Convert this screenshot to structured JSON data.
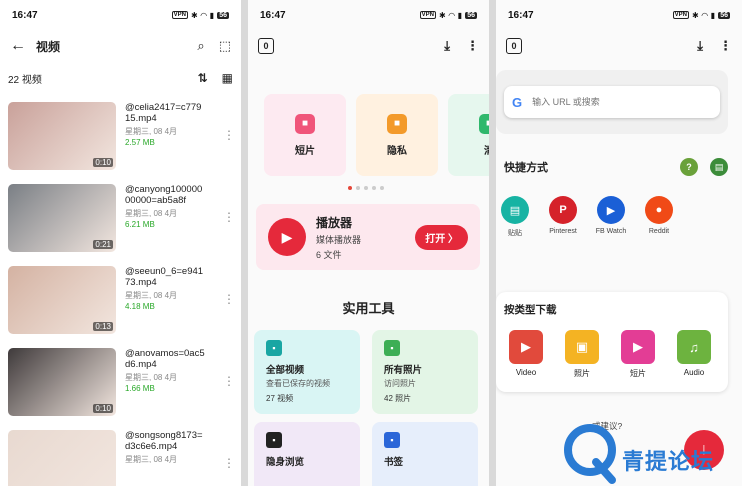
{
  "status": {
    "time": "16:47",
    "vpn": "VPN",
    "battery": "56"
  },
  "panel1": {
    "title": "视频",
    "count": "22 视频",
    "videos": [
      {
        "name": "@celia2417=c77915.mp4",
        "date": "星期三, 08 4月",
        "size": "2.57 MB",
        "duration": "0:10"
      },
      {
        "name": "@canyong10000000000=ab5a8f",
        "date": "星期三, 08 4月",
        "size": "6.21 MB",
        "duration": "0:21"
      },
      {
        "name": "@seeun0_6=e94173.mp4",
        "date": "星期三, 08 4月",
        "size": "4.18 MB",
        "duration": "0:13"
      },
      {
        "name": "@anovamos=0ac5d6.mp4",
        "date": "星期三, 08 4月",
        "size": "1.66 MB",
        "duration": "0:10"
      },
      {
        "name": "@songsong8173=d3c6e6.mp4",
        "date": "星期三, 08 4月",
        "size": "",
        "duration": ""
      }
    ]
  },
  "panel2": {
    "zero": "0",
    "categories": [
      {
        "label": "短片",
        "color": "#fdeaf1",
        "icon_color": "#f0557a"
      },
      {
        "label": "隐私",
        "color": "#fff1e0",
        "icon_color": "#f39a2a"
      },
      {
        "label": "清",
        "color": "#e6f7ee",
        "icon_color": "#2fb86c"
      }
    ],
    "player": {
      "title": "播放器",
      "subtitle": "媒体播放器",
      "files": "6 文件",
      "open": "打开 〉"
    },
    "tools_title": "实用工具",
    "tools": [
      {
        "name": "全部视频",
        "desc": "查看已保存的视频",
        "count": "27 视频",
        "bg": "#d9f5f4",
        "ic": "#19a6a3"
      },
      {
        "name": "所有照片",
        "desc": "访问照片",
        "count": "42 照片",
        "bg": "#e3f5e6",
        "ic": "#3dae55"
      },
      {
        "name": "隐身浏览",
        "desc": "",
        "count": "",
        "bg": "#f1e8f7",
        "ic": "#222222"
      },
      {
        "name": "书签",
        "desc": "",
        "count": "",
        "bg": "#e6eefb",
        "ic": "#2b66d8"
      }
    ]
  },
  "panel3": {
    "zero": "0",
    "search_placeholder": "输入 URL 或搜索",
    "shortcut_label": "快捷方式",
    "shortcuts": [
      {
        "label": "贴贴",
        "color": "#17b3a3",
        "glyph": "▤"
      },
      {
        "label": "Pinterest",
        "color": "#d5222a",
        "glyph": "P"
      },
      {
        "label": "FB Watch",
        "color": "#1a5fd6",
        "glyph": "▶"
      },
      {
        "label": "Reddit",
        "color": "#f04a17",
        "glyph": "●"
      }
    ],
    "type_title": "按类型下载",
    "types": [
      {
        "label": "Video",
        "color": "#e14a3c",
        "glyph": "▶"
      },
      {
        "label": "照片",
        "color": "#f4b323",
        "glyph": "▣"
      },
      {
        "label": "短片",
        "color": "#e33d95",
        "glyph": "▶"
      },
      {
        "label": "Audio",
        "color": "#6db33f",
        "glyph": "♫"
      }
    ],
    "suggest": "或建议?"
  },
  "watermark": {
    "text": "青提论坛"
  }
}
